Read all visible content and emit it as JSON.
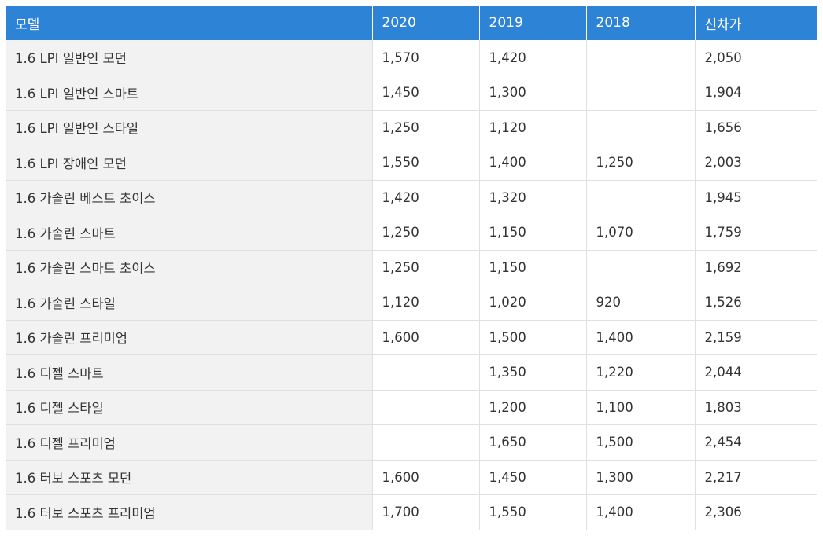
{
  "table": {
    "headers": [
      "모델",
      "2020",
      "2019",
      "2018",
      "신차가"
    ],
    "rows": [
      [
        "1.6 LPI 일반인 모던",
        "1,570",
        "1,420",
        "",
        "2,050"
      ],
      [
        "1.6 LPI 일반인 스마트",
        "1,450",
        "1,300",
        "",
        "1,904"
      ],
      [
        "1.6 LPI 일반인 스타일",
        "1,250",
        "1,120",
        "",
        "1,656"
      ],
      [
        "1.6 LPI 장애인 모던",
        "1,550",
        "1,400",
        "1,250",
        "2,003"
      ],
      [
        "1.6 가솔린 베스트 초이스",
        "1,420",
        "1,320",
        "",
        "1,945"
      ],
      [
        "1.6 가솔린 스마트",
        "1,250",
        "1,150",
        "1,070",
        "1,759"
      ],
      [
        "1.6 가솔린 스마트 초이스",
        "1,250",
        "1,150",
        "",
        "1,692"
      ],
      [
        "1.6 가솔린 스타일",
        "1,120",
        "1,020",
        "920",
        "1,526"
      ],
      [
        "1.6 가솔린 프리미엄",
        "1,600",
        "1,500",
        "1,400",
        "2,159"
      ],
      [
        "1.6 디젤 스마트",
        "",
        "1,350",
        "1,220",
        "2,044"
      ],
      [
        "1.6 디젤 스타일",
        "",
        "1,200",
        "1,100",
        "1,803"
      ],
      [
        "1.6 디젤 프리미엄",
        "",
        "1,650",
        "1,500",
        "2,454"
      ],
      [
        "1.6 터보 스포츠 모던",
        "1,600",
        "1,450",
        "1,300",
        "2,217"
      ],
      [
        "1.6 터보 스포츠 프리미엄",
        "1,700",
        "1,550",
        "1,400",
        "2,306"
      ]
    ]
  },
  "colors": {
    "header_bg": "#2d84d6",
    "model_cell_bg": "#f2f2f2",
    "border": "#e0e0e0"
  }
}
